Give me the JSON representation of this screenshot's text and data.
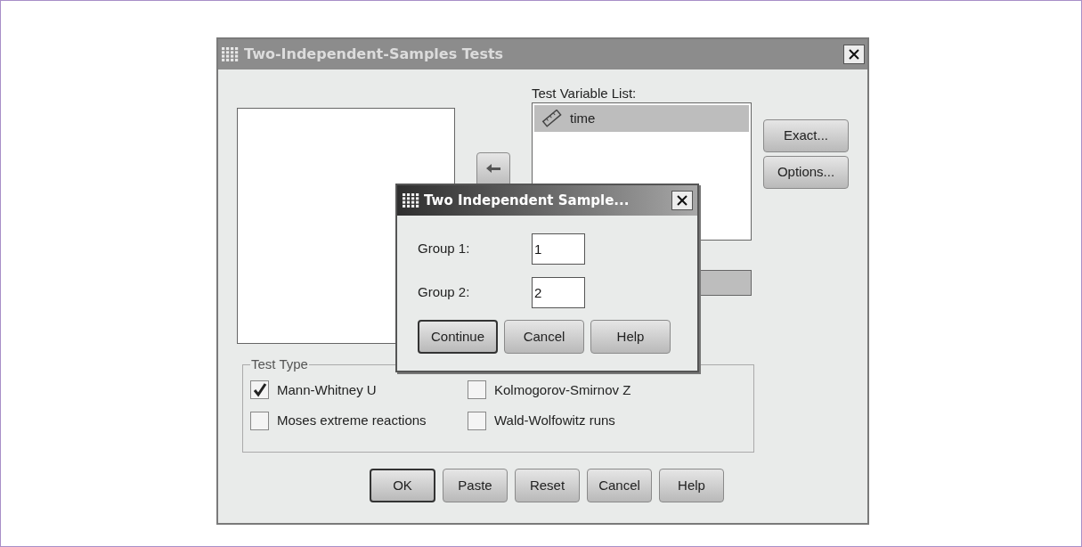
{
  "dialog": {
    "title": "Two-Independent-Samples Tests",
    "test_variable_list": {
      "label": "Test Variable List:",
      "items": [
        {
          "name": "time",
          "selected": true
        }
      ]
    },
    "side_buttons": [
      "Exact...",
      "Options..."
    ],
    "test_type": {
      "label": "Test Type",
      "options": [
        {
          "label": "Mann-Whitney U",
          "checked": true
        },
        {
          "label": "Kolmogorov-Smirnov Z",
          "checked": false
        },
        {
          "label": "Moses extreme reactions",
          "checked": false
        },
        {
          "label": "Wald-Wolfowitz runs",
          "checked": false
        }
      ]
    },
    "buttons": [
      {
        "label": "OK",
        "default": true
      },
      {
        "label": "Paste",
        "default": false
      },
      {
        "label": "Reset",
        "default": false
      },
      {
        "label": "Cancel",
        "default": false
      },
      {
        "label": "Help",
        "default": false
      }
    ]
  },
  "subdialog": {
    "title": "Two Independent Sample...",
    "fields": [
      {
        "label": "Group 1:",
        "value": "1"
      },
      {
        "label": "Group 2:",
        "value": "2"
      }
    ],
    "buttons": [
      {
        "label": "Continue",
        "default": true
      },
      {
        "label": "Cancel",
        "default": false
      },
      {
        "label": "Help",
        "default": false
      }
    ]
  }
}
